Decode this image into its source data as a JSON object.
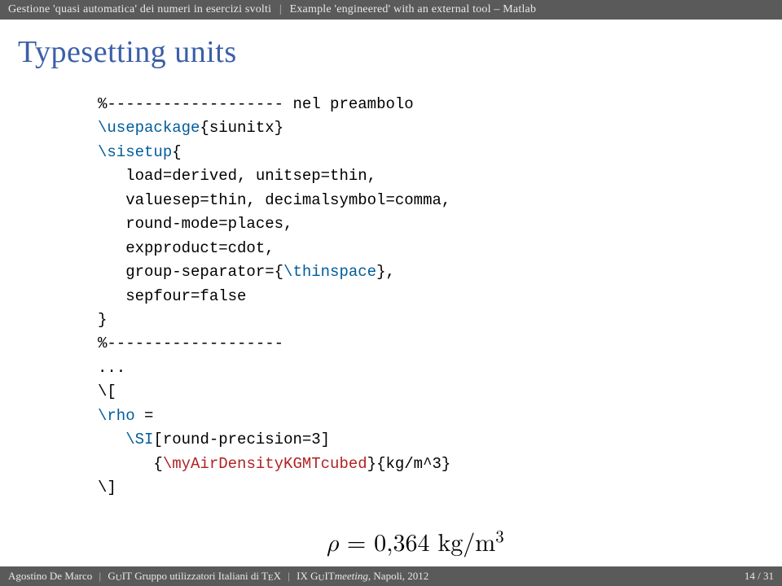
{
  "header": {
    "crumb1": "Gestione 'quasi automatica' dei numeri in esercizi svolti",
    "crumb2": "Example 'engineered' with an external tool – Matlab"
  },
  "title": "Typesetting units",
  "code": {
    "l01a": "%------------------- ",
    "l01b": "nel preambolo",
    "l02a": "\\usepackage",
    "l02b": "{siunitx}",
    "l03a": "\\sisetup",
    "l03b": "{",
    "l04": "   load=derived, unitsep=thin,",
    "l05": "   valuesep=thin, decimalsymbol=comma,",
    "l06": "   round-mode=places,",
    "l07": "   expproduct=cdot,",
    "l08a": "   group-separator={",
    "l08b": "\\thinspace",
    "l08c": "},",
    "l09": "   sepfour=false",
    "l10": "}",
    "l11": "%-------------------",
    "l12": "...",
    "l13": "\\[",
    "l14a": "\\rho",
    "l14b": " =",
    "l15a": "   ",
    "l15b": "\\SI",
    "l15c": "[round-precision=3]",
    "l16a": "      {",
    "l16b": "\\myAirDensityKGMTcubed",
    "l16c": "}{kg/m^3}",
    "l17": "\\]"
  },
  "equation": {
    "lhs": "ρ",
    "eq": " = ",
    "val": "0,364",
    "sp": " ",
    "unit_kg": "kg",
    "unit_slash": "/",
    "unit_m": "m",
    "unit_exp": "3"
  },
  "footer": {
    "author": "Agostino De Marco",
    "group": "Gruppo utilizzatori Italiani di T",
    "tex_e": "E",
    "tex_x": "X",
    "meeting_pre": "IX ",
    "meeting": "meeting",
    "loc": ", Napoli, 2012",
    "page": "14 / 31",
    "guit_g": "G",
    "guit_u": "U",
    "guit_it": "IT"
  }
}
